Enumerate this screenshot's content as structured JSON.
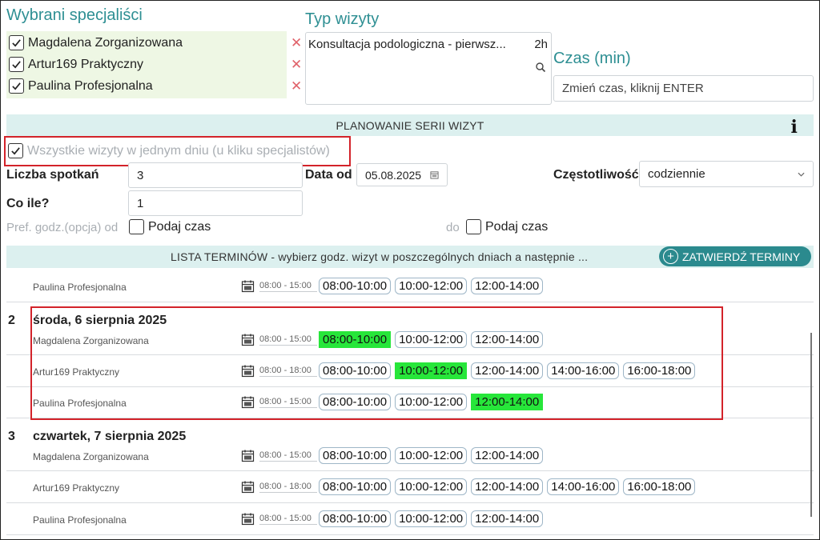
{
  "specialists": {
    "title": "Wybrani specjaliści",
    "items": [
      {
        "name": "Magdalena Zorganizowana",
        "checked": true
      },
      {
        "name": "Artur169 Praktyczny",
        "checked": true
      },
      {
        "name": "Paulina Profesjonalna",
        "checked": true
      }
    ],
    "remove_icon": "close-icon",
    "remove_glyph": "✕",
    "bg_color": "#eef7e4"
  },
  "visit_type": {
    "title": "Typ wizyty",
    "value": "Konsultacja podologiczna - pierwsz...",
    "duration": "2h",
    "search_icon": "search-icon"
  },
  "duration": {
    "title": "Czas (min)",
    "placeholder": "Zmień czas, kliknij ENTER"
  },
  "series": {
    "header": "PLANOWANIE SERII WIZYT",
    "info_glyph": "i",
    "all_in_one_day_label": "Wszystkie wizyty w jednym dniu (u kliku specjalistów)",
    "all_in_one_day_checked": true,
    "count_label": "Liczba spotkań",
    "count_value": "3",
    "every_label": "Co ile?",
    "every_value": "1",
    "date_from_label": "Data od",
    "date_from_value": "05.08.2025",
    "frequency_label": "Częstotliwość",
    "frequency_value": "codziennie",
    "pref_label": "Pref. godz.(opcja) od",
    "pref_from_checkbox": "Podaj czas",
    "pref_to_label": "do",
    "pref_to_checkbox": "Podaj czas"
  },
  "list": {
    "header": "LISTA TERMINÓW  -  wybierz godz. wizyt w poszczególnych dniach a następnie ...",
    "confirm_label": "ZATWIERDŹ TERMINY",
    "confirm_glyph": "+",
    "accent_color": "#2b8a8e",
    "selected_color": "#27e63a",
    "highlight_color": "#d3232a",
    "partial_row": {
      "specialist": "Paulina Profesjonalna",
      "range": "08:00 - 15:00",
      "slots": [
        "08:00-10:00",
        "10:00-12:00",
        "12:00-14:00"
      ]
    },
    "days": [
      {
        "number": "2",
        "label": "środa, 6 sierpnia 2025",
        "rows": [
          {
            "specialist": "Magdalena Zorganizowana",
            "range": "08:00 - 15:00",
            "slots": [
              "08:00-10:00",
              "10:00-12:00",
              "12:00-14:00"
            ],
            "selected": 0
          },
          {
            "specialist": "Artur169 Praktyczny",
            "range": "08:00 - 18:00",
            "slots": [
              "08:00-10:00",
              "10:00-12:00",
              "12:00-14:00",
              "14:00-16:00",
              "16:00-18:00"
            ],
            "selected": 1
          },
          {
            "specialist": "Paulina Profesjonalna",
            "range": "08:00 - 15:00",
            "slots": [
              "08:00-10:00",
              "10:00-12:00",
              "12:00-14:00"
            ],
            "selected": 2
          }
        ]
      },
      {
        "number": "3",
        "label": "czwartek, 7 sierpnia 2025",
        "rows": [
          {
            "specialist": "Magdalena Zorganizowana",
            "range": "08:00 - 15:00",
            "slots": [
              "08:00-10:00",
              "10:00-12:00",
              "12:00-14:00"
            ],
            "selected": -1
          },
          {
            "specialist": "Artur169 Praktyczny",
            "range": "08:00 - 18:00",
            "slots": [
              "08:00-10:00",
              "10:00-12:00",
              "12:00-14:00",
              "14:00-16:00",
              "16:00-18:00"
            ],
            "selected": -1
          },
          {
            "specialist": "Paulina Profesjonalna",
            "range": "08:00 - 15:00",
            "slots": [
              "08:00-10:00",
              "10:00-12:00",
              "12:00-14:00"
            ],
            "selected": -1
          }
        ]
      }
    ]
  }
}
